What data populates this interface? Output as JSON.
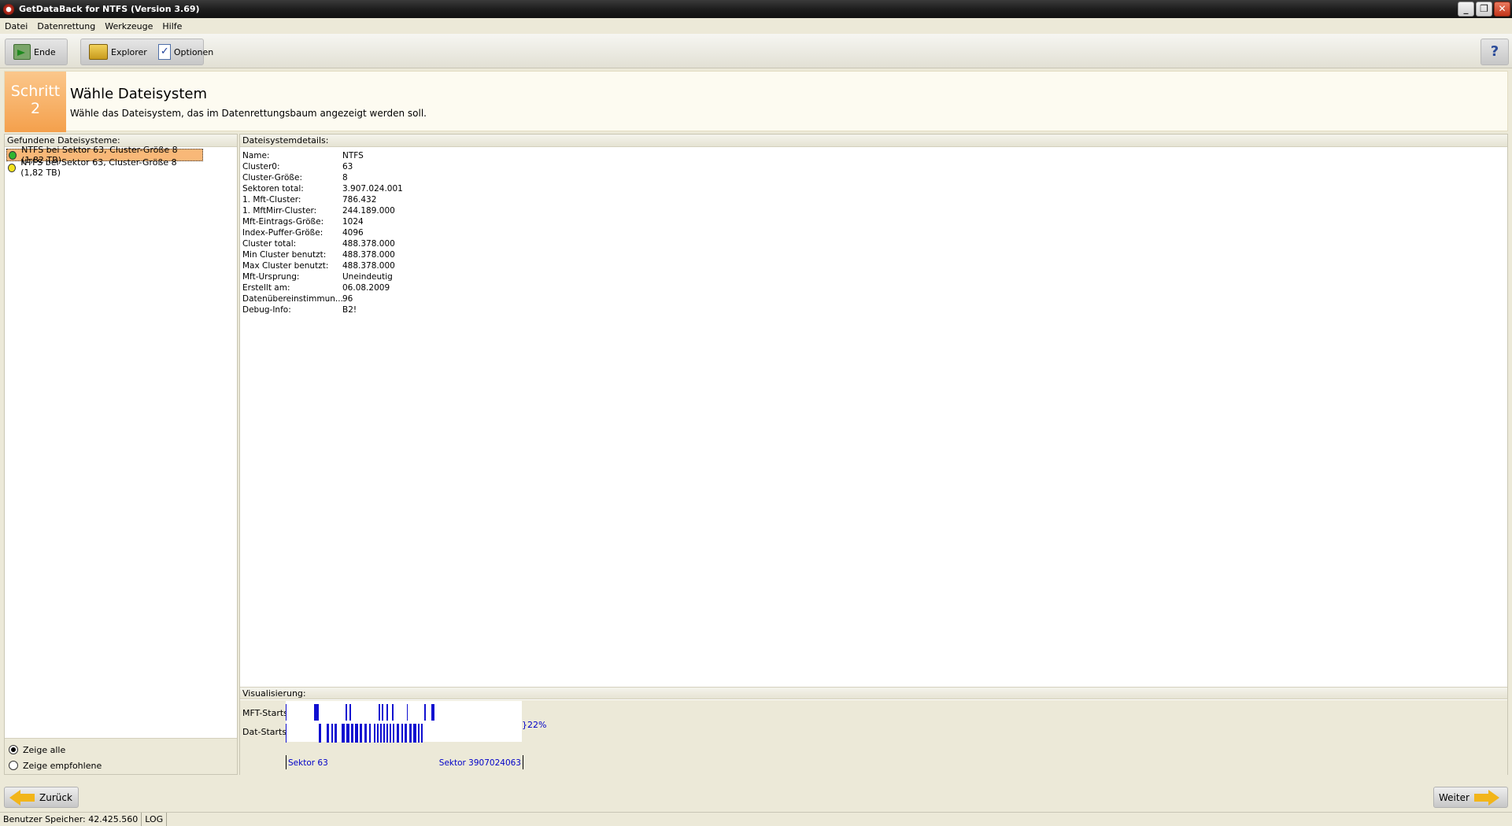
{
  "window": {
    "title": "GetDataBack for NTFS (Version 3.69)"
  },
  "menu": [
    "Datei",
    "Datenrettung",
    "Werkzeuge",
    "Hilfe"
  ],
  "toolbar": {
    "exit_label": "Ende",
    "explorer_label": "Explorer",
    "options_label": "Optionen",
    "help_label": "?"
  },
  "step": {
    "word": "Schritt",
    "number": "2",
    "title": "Wähle Dateisystem",
    "description": "Wähle das Dateisystem, das im Datenrettungsbaum angezeigt werden soll."
  },
  "left_panel": {
    "header": "Gefundene Dateisysteme:",
    "items": [
      {
        "label": "NTFS bei Sektor 63, Cluster-Größe 8 (1,82 TB)",
        "status_color": "#2fb52f",
        "selected": true
      },
      {
        "label": "NTFS bei Sektor 63, Cluster-Größe 8 (1,82 TB)",
        "status_color": "#f2e21c",
        "selected": false
      }
    ],
    "radio_all": "Zeige alle",
    "radio_recommended": "Zeige empfohlene",
    "radio_selected": "all"
  },
  "details": {
    "header": "Dateisystemdetails:",
    "rows": [
      {
        "key": "Name:",
        "value": "NTFS"
      },
      {
        "key": "Cluster0:",
        "value": "63"
      },
      {
        "key": "Cluster-Größe:",
        "value": "8"
      },
      {
        "key": "Sektoren total:",
        "value": "3.907.024.001"
      },
      {
        "key": "1. Mft-Cluster:",
        "value": "786.432"
      },
      {
        "key": "1. MftMirr-Cluster:",
        "value": "244.189.000"
      },
      {
        "key": "Mft-Eintrags-Größe:",
        "value": "1024"
      },
      {
        "key": "Index-Puffer-Größe:",
        "value": "4096"
      },
      {
        "key": "Cluster total:",
        "value": "488.378.000"
      },
      {
        "key": "Min Cluster benutzt:",
        "value": "488.378.000"
      },
      {
        "key": "Max Cluster benutzt:",
        "value": "488.378.000"
      },
      {
        "key": "Mft-Ursprung:",
        "value": "Uneindeutig"
      },
      {
        "key": "Erstellt am:",
        "value": "06.08.2009"
      },
      {
        "key": "Datenübereinstimmun...",
        "value": "96"
      },
      {
        "key": "Debug-Info:",
        "value": "B2!"
      }
    ]
  },
  "visualization": {
    "header": "Visualisierung:",
    "mft_label": "MFT-Starts",
    "dat_label": "Dat-Starts:",
    "percent": "}22%",
    "start_label": "Sektor 63",
    "end_label": "Sektor 3907024063",
    "bar_color": "#1010d0"
  },
  "nav": {
    "back_label": "Zurück",
    "next_label": "Weiter"
  },
  "status": {
    "memory": "Benutzer Speicher: 42.425.560",
    "log": "LOG"
  }
}
